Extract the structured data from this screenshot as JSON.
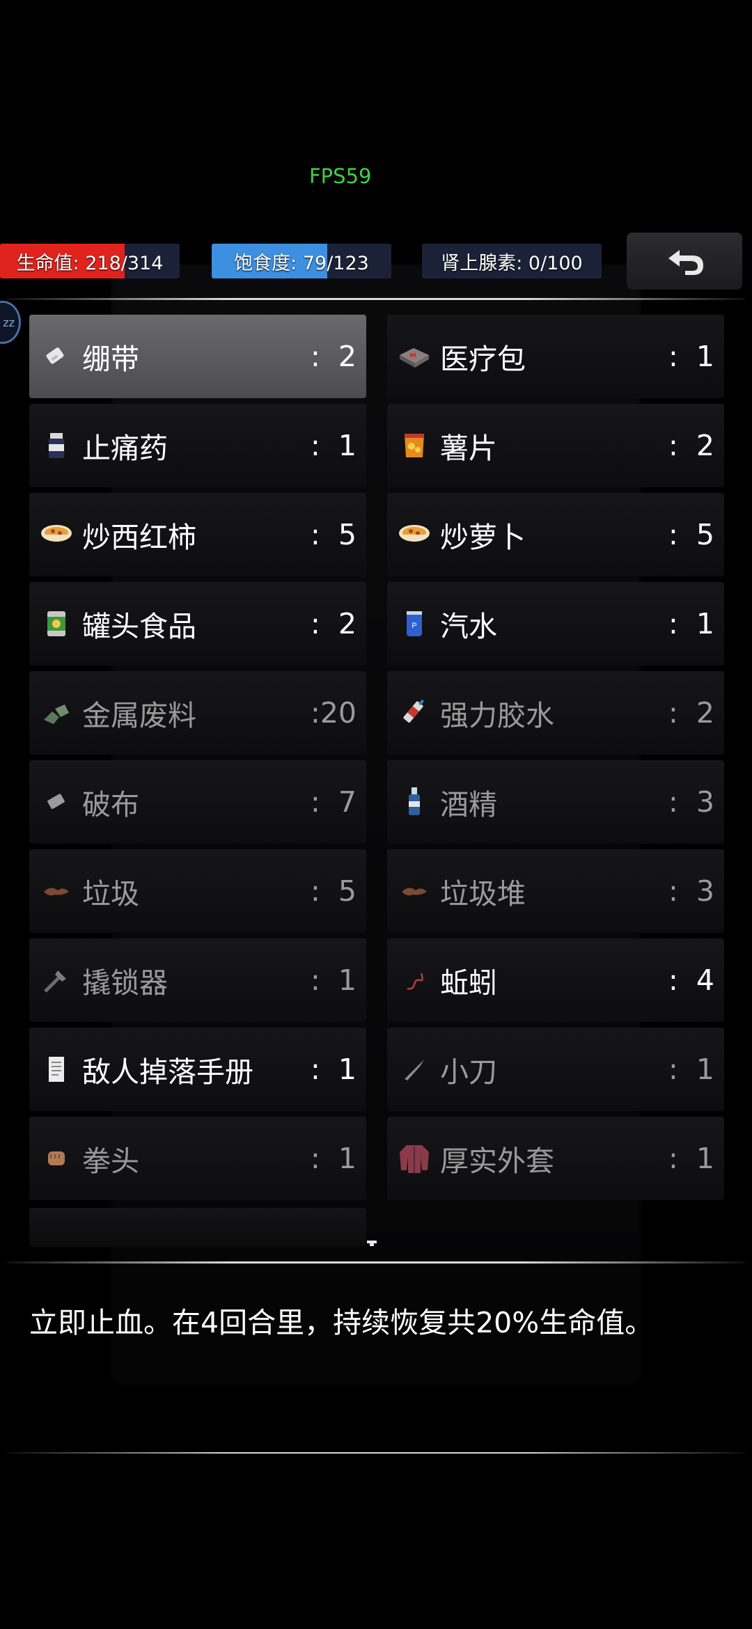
{
  "fps": "FPS59",
  "stats": {
    "health": {
      "label": "生命值: 218/314",
      "fraction": 0.694,
      "color": "#e0231d",
      "track": "#1b2238"
    },
    "satiety": {
      "label": "饱食度: 79/123",
      "fraction": 0.642,
      "color": "#3d8fe0",
      "track": "#1b2238"
    },
    "adrenaline": {
      "label": "肾上腺素: 0/100",
      "fraction": 0.0,
      "color": "#7a3ad0",
      "track": "#1b2238"
    }
  },
  "back_icon": "back-arrow-icon",
  "status_badge": "zz",
  "inventory": [
    {
      "name": "绷带",
      "count": ":  2",
      "icon": "bandage-icon",
      "selected": true,
      "dim": false
    },
    {
      "name": "医疗包",
      "count": ":  1",
      "icon": "medkit-icon",
      "selected": false,
      "dim": false
    },
    {
      "name": "止痛药",
      "count": ":  1",
      "icon": "pill-bottle-icon",
      "selected": false,
      "dim": false
    },
    {
      "name": "薯片",
      "count": ":  2",
      "icon": "chips-icon",
      "selected": false,
      "dim": false
    },
    {
      "name": "炒西红柿",
      "count": ":  5",
      "icon": "bowl-icon",
      "selected": false,
      "dim": false
    },
    {
      "name": "炒萝卜",
      "count": ":  5",
      "icon": "bowl-icon",
      "selected": false,
      "dim": false
    },
    {
      "name": "罐头食品",
      "count": ":  2",
      "icon": "can-icon",
      "selected": false,
      "dim": false
    },
    {
      "name": "汽水",
      "count": ":  1",
      "icon": "soda-can-icon",
      "selected": false,
      "dim": false
    },
    {
      "name": "金属废料",
      "count": ":20",
      "icon": "scrap-metal-icon",
      "selected": false,
      "dim": true
    },
    {
      "name": "强力胶水",
      "count": ":  2",
      "icon": "glue-icon",
      "selected": false,
      "dim": true
    },
    {
      "name": "破布",
      "count": ":  7",
      "icon": "rag-icon",
      "selected": false,
      "dim": true
    },
    {
      "name": "酒精",
      "count": ":  3",
      "icon": "alcohol-bottle-icon",
      "selected": false,
      "dim": true
    },
    {
      "name": "垃圾",
      "count": ":  5",
      "icon": "trash-icon",
      "selected": false,
      "dim": true
    },
    {
      "name": "垃圾堆",
      "count": ":  3",
      "icon": "trash-pile-icon",
      "selected": false,
      "dim": true
    },
    {
      "name": "撬锁器",
      "count": ":  1",
      "icon": "lockpick-icon",
      "selected": false,
      "dim": true
    },
    {
      "name": "蚯蚓",
      "count": ":  4",
      "icon": "worm-icon",
      "selected": false,
      "dim": false
    },
    {
      "name": "敌人掉落手册",
      "count": ":  1",
      "icon": "scroll-icon",
      "selected": false,
      "dim": false
    },
    {
      "name": "小刀",
      "count": ":  1",
      "icon": "knife-icon",
      "selected": false,
      "dim": true
    },
    {
      "name": "拳头",
      "count": ":  1",
      "icon": "fist-icon",
      "selected": false,
      "dim": true
    },
    {
      "name": "厚实外套",
      "count": ":  1",
      "icon": "coat-icon",
      "selected": false,
      "dim": true
    }
  ],
  "description": "立即止血。在4回合里，持续恢复共20%生命值。"
}
